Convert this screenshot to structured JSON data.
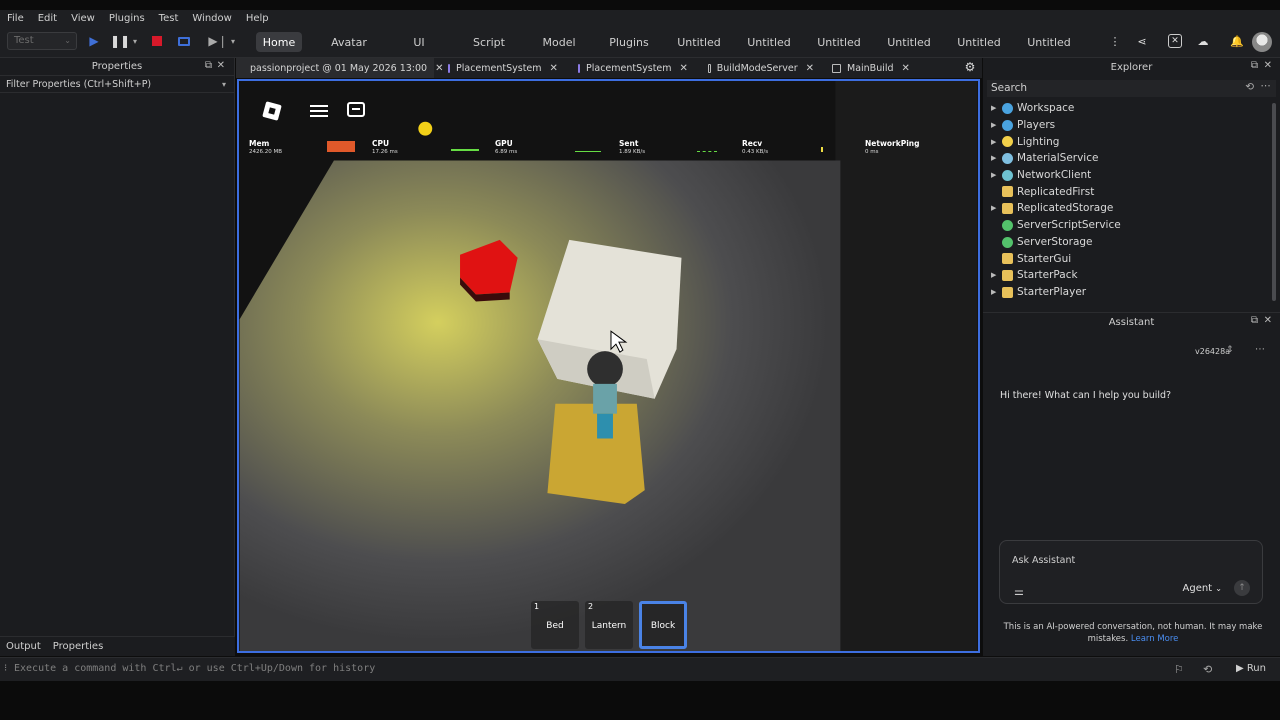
{
  "menubar": {
    "items": [
      "File",
      "Edit",
      "View",
      "Plugins",
      "Test",
      "Window",
      "Help"
    ]
  },
  "toolbar": {
    "test_dropdown": "Test",
    "tabs": [
      "Home",
      "Avatar",
      "UI",
      "Script",
      "Model",
      "Plugins",
      "Untitled",
      "Untitled",
      "Untitled",
      "Untitled",
      "Untitled",
      "Untitled"
    ],
    "active_tab": "Home"
  },
  "properties_panel": {
    "title": "Properties",
    "filter_placeholder": "Filter Properties (Ctrl+Shift+P)",
    "bottom_tabs": [
      "Output",
      "Properties"
    ]
  },
  "doc_tabs": [
    {
      "label": "passionproject @ 01 May 2026 13:00",
      "icon": "place-icon"
    },
    {
      "label": "PlacementSystem",
      "icon": "script-icon"
    },
    {
      "label": "PlacementSystem",
      "icon": "script-icon"
    },
    {
      "label": "BuildModeServer",
      "icon": "document-icon"
    },
    {
      "label": "MainBuild",
      "icon": "document-icon"
    }
  ],
  "viewport": {
    "stats": [
      {
        "name": "Mem",
        "value": "2426.20 MB",
        "graph_color": "#e0592a"
      },
      {
        "name": "CPU",
        "value": "17.26 ms",
        "graph_color": "#66dd44"
      },
      {
        "name": "GPU",
        "value": "6.89 ms",
        "graph_color": "#66dd44"
      },
      {
        "name": "Sent",
        "value": "1.89 KB/s",
        "graph_color": "#66dd44"
      },
      {
        "name": "Recv",
        "value": "0.43 KB/s",
        "graph_color": "#eedd44"
      },
      {
        "name": "NetworkPing",
        "value": "0 ms",
        "graph_color": "#66dd44"
      }
    ],
    "hotbar": [
      {
        "num": "1",
        "label": "Bed",
        "selected": false
      },
      {
        "num": "2",
        "label": "Lantern",
        "selected": false
      },
      {
        "num": "",
        "label": "Block",
        "selected": true
      }
    ]
  },
  "explorer": {
    "title": "Explorer",
    "search_placeholder": "Search",
    "items": [
      {
        "label": "Workspace",
        "expandable": true,
        "icon_color": "#4aa3df"
      },
      {
        "label": "Players",
        "expandable": true,
        "icon_color": "#4aa3df"
      },
      {
        "label": "Lighting",
        "expandable": true,
        "icon_color": "#f2d04a"
      },
      {
        "label": "MaterialService",
        "expandable": true,
        "icon_color": "#7fbfe0"
      },
      {
        "label": "NetworkClient",
        "expandable": true,
        "icon_color": "#6ec2d1"
      },
      {
        "label": "ReplicatedFirst",
        "expandable": false,
        "icon_color": "#e8c15a"
      },
      {
        "label": "ReplicatedStorage",
        "expandable": true,
        "icon_color": "#e8c15a"
      },
      {
        "label": "ServerScriptService",
        "expandable": false,
        "icon_color": "#53c26b"
      },
      {
        "label": "ServerStorage",
        "expandable": false,
        "icon_color": "#53c26b"
      },
      {
        "label": "StarterGui",
        "expandable": false,
        "icon_color": "#e8c15a"
      },
      {
        "label": "StarterPack",
        "expandable": true,
        "icon_color": "#e8c15a"
      },
      {
        "label": "StarterPlayer",
        "expandable": true,
        "icon_color": "#e8c15a"
      }
    ]
  },
  "assistant": {
    "title": "Assistant",
    "version": "v26428a",
    "greeting": "Hi there! What can I help you build?",
    "input_placeholder": "Ask Assistant",
    "mode": "Agent",
    "disclaimer": "This is an AI-powered conversation, not human. It may make mistakes.",
    "learn_more": "Learn More"
  },
  "command_bar": {
    "placeholder": "Execute a command with Ctrl↵ or use Ctrl+Up/Down for history",
    "run_label": "Run"
  }
}
